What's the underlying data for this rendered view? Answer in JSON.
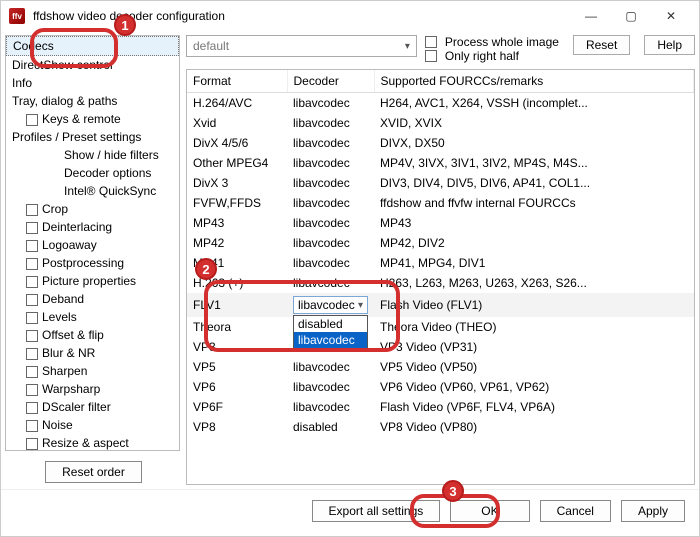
{
  "window": {
    "title": "ffdshow video decoder configuration"
  },
  "titlebar": {
    "min": "—",
    "max": "▢",
    "close": "✕"
  },
  "topbar": {
    "preset": "default",
    "process_whole": "Process whole image",
    "only_right": "Only right half",
    "reset": "Reset",
    "help": "Help"
  },
  "sidebar": {
    "items": [
      {
        "label": "Codecs",
        "indent": 0,
        "sel": true
      },
      {
        "label": "DirectShow control",
        "indent": 0
      },
      {
        "label": "Info",
        "indent": 0
      },
      {
        "label": "Tray, dialog & paths",
        "indent": 0
      },
      {
        "label": "Keys & remote",
        "indent": 1,
        "chk": true
      },
      {
        "label": "Profiles / Preset settings",
        "indent": 0
      },
      {
        "label": "Show / hide filters",
        "indent": 2
      },
      {
        "label": "Decoder options",
        "indent": 2
      },
      {
        "label": "Intel® QuickSync",
        "indent": 2
      },
      {
        "label": "Crop",
        "indent": 1,
        "chk": true
      },
      {
        "label": "Deinterlacing",
        "indent": 1,
        "chk": true
      },
      {
        "label": "Logoaway",
        "indent": 1,
        "chk": true
      },
      {
        "label": "Postprocessing",
        "indent": 1,
        "chk": true
      },
      {
        "label": "Picture properties",
        "indent": 1,
        "chk": true
      },
      {
        "label": "Deband",
        "indent": 1,
        "chk": true
      },
      {
        "label": "Levels",
        "indent": 1,
        "chk": true
      },
      {
        "label": "Offset & flip",
        "indent": 1,
        "chk": true
      },
      {
        "label": "Blur & NR",
        "indent": 1,
        "chk": true
      },
      {
        "label": "Sharpen",
        "indent": 1,
        "chk": true
      },
      {
        "label": "Warpsharp",
        "indent": 1,
        "chk": true
      },
      {
        "label": "DScaler filter",
        "indent": 1,
        "chk": true
      },
      {
        "label": "Noise",
        "indent": 1,
        "chk": true
      },
      {
        "label": "Resize & aspect",
        "indent": 1,
        "chk": true
      }
    ],
    "reset_order": "Reset order"
  },
  "table": {
    "headers": {
      "format": "Format",
      "decoder": "Decoder",
      "remarks": "Supported FOURCCs/remarks"
    },
    "rows": [
      {
        "f": "H.264/AVC",
        "d": "libavcodec",
        "r": "H264, AVC1, X264, VSSH (incomplet..."
      },
      {
        "f": "Xvid",
        "d": "libavcodec",
        "r": "XVID, XVIX"
      },
      {
        "f": "DivX 4/5/6",
        "d": "libavcodec",
        "r": "DIVX, DX50"
      },
      {
        "f": "Other MPEG4",
        "d": "libavcodec",
        "r": "MP4V, 3IVX, 3IV1, 3IV2, MP4S, M4S..."
      },
      {
        "f": "DivX 3",
        "d": "libavcodec",
        "r": "DIV3, DIV4, DIV5, DIV6, AP41, COL1..."
      },
      {
        "f": "FVFW,FFDS",
        "d": "libavcodec",
        "r": "ffdshow and ffvfw internal FOURCCs"
      },
      {
        "f": "MP43",
        "d": "libavcodec",
        "r": "MP43"
      },
      {
        "f": "MP42",
        "d": "libavcodec",
        "r": "MP42, DIV2"
      },
      {
        "f": "MP41",
        "d": "libavcodec",
        "r": "MP41, MPG4, DIV1"
      },
      {
        "f": "H.263 (+)",
        "d": "libavcodec",
        "r": "H263, L263, M263, U263, X263, S26..."
      },
      {
        "f": "FLV1",
        "d": "libavcodec",
        "r": "Flash Video (FLV1)",
        "hl": true,
        "dd": true
      },
      {
        "f": "Theora",
        "d": "disabled",
        "r": "Theora Video (THEO)"
      },
      {
        "f": "VP3",
        "d": "libavcodec",
        "r": "VP3 Video (VP31)"
      },
      {
        "f": "VP5",
        "d": "libavcodec",
        "r": "VP5 Video (VP50)"
      },
      {
        "f": "VP6",
        "d": "libavcodec",
        "r": "VP6 Video (VP60, VP61, VP62)"
      },
      {
        "f": "VP6F",
        "d": "libavcodec",
        "r": "Flash Video (VP6F, FLV4, VP6A)"
      },
      {
        "f": "VP8",
        "d": "disabled",
        "r": "VP8 Video (VP80)"
      }
    ],
    "dropdown": {
      "opt1": "disabled",
      "opt2": "libavcodec"
    }
  },
  "footer": {
    "export": "Export all settings",
    "ok": "OK",
    "cancel": "Cancel",
    "apply": "Apply"
  },
  "callouts": {
    "c1": "1",
    "c2": "2",
    "c3": "3"
  }
}
